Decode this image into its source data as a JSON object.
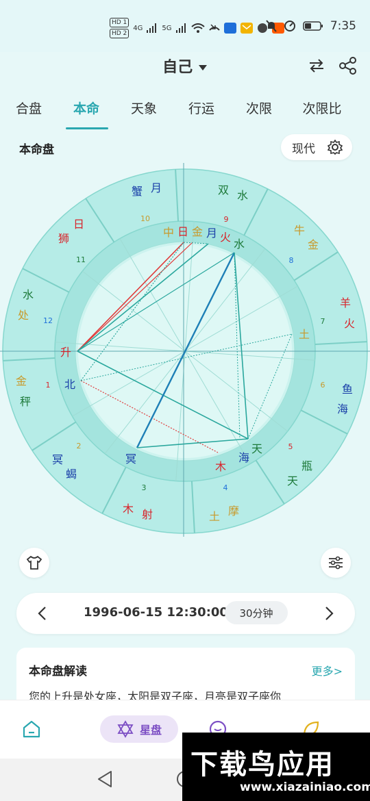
{
  "status_bar": {
    "hd1": "HD 1",
    "hd2": "HD 2",
    "net1": "4G",
    "net2": "5G",
    "time": "7:35"
  },
  "header": {
    "title": "自己"
  },
  "tabs": [
    "合盘",
    "本命",
    "天象",
    "行运",
    "次限",
    "次限比"
  ],
  "active_tab": "本命",
  "chart_section": {
    "title": "本命盘",
    "mode_label": "现代"
  },
  "wheel": {
    "house_numbers": [
      "1",
      "2",
      "3",
      "4",
      "5",
      "6",
      "7",
      "8",
      "9",
      "10",
      "11",
      "12"
    ],
    "signs": [
      {
        "top": "蟹",
        "bottom": "月"
      },
      {
        "top": "双",
        "bottom": "水"
      },
      {
        "top": "牛",
        "bottom": "金"
      },
      {
        "top": "羊",
        "bottom": "火"
      },
      {
        "top": "鱼",
        "bottom": "海"
      },
      {
        "top": "瓶",
        "bottom": "天"
      },
      {
        "top": "摩",
        "bottom": "土"
      },
      {
        "top": "射",
        "bottom": "木"
      },
      {
        "top": "蝎",
        "bottom": "冥"
      },
      {
        "top": "秤",
        "bottom": "金"
      },
      {
        "top": "处",
        "bottom": "水"
      },
      {
        "top": "狮",
        "bottom": "日"
      }
    ],
    "planets": [
      "中",
      "日",
      "金",
      "月",
      "火",
      "水",
      "土",
      "天",
      "海",
      "木",
      "冥",
      "北",
      "升"
    ]
  },
  "colors": {
    "accent": "#29a7b0",
    "ring_outer": "#b6ece7",
    "ring_mid": "#cdf3ef",
    "ring_inner": "#d8f6f3",
    "red": "#d8232a",
    "blue": "#1a3fa8",
    "green": "#1d7a3a",
    "gold": "#c89a2c"
  },
  "date_bar": {
    "datetime": "1996-06-15 12:30:00",
    "step": "30分钟"
  },
  "reading_card": {
    "title": "本命盘解读",
    "more": "更多>",
    "text": "您的上升是处女座，太阳是双子座，月亮是双子座你"
  },
  "bottom_nav": {
    "active_label": "星盘"
  },
  "watermark": {
    "big": "下载鸟应用",
    "url": "www.xiazainiao.com"
  }
}
